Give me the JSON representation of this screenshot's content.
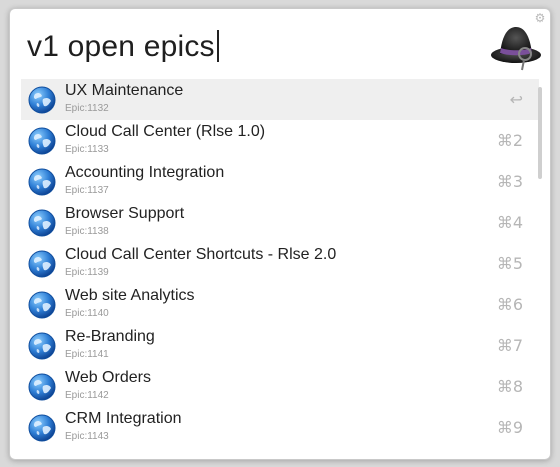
{
  "search": {
    "query": "v1 open epics"
  },
  "results": [
    {
      "title": "UX Maintenance",
      "subtitle": "Epic:1132",
      "shortcut": "↩"
    },
    {
      "title": "Cloud Call Center (Rlse 1.0)",
      "subtitle": "Epic:1133",
      "shortcut": "⌘2"
    },
    {
      "title": "Accounting Integration",
      "subtitle": "Epic:1137",
      "shortcut": "⌘3"
    },
    {
      "title": "Browser Support",
      "subtitle": "Epic:1138",
      "shortcut": "⌘4"
    },
    {
      "title": "Cloud Call Center Shortcuts - Rlse 2.0",
      "subtitle": "Epic:1139",
      "shortcut": "⌘5"
    },
    {
      "title": "Web site Analytics",
      "subtitle": "Epic:1140",
      "shortcut": "⌘6"
    },
    {
      "title": "Re-Branding",
      "subtitle": "Epic:1141",
      "shortcut": "⌘7"
    },
    {
      "title": "Web Orders",
      "subtitle": "Epic:1142",
      "shortcut": "⌘8"
    },
    {
      "title": "CRM Integration",
      "subtitle": "Epic:1143",
      "shortcut": "⌘9"
    }
  ],
  "icons": {
    "settings": "gear-icon",
    "app": "alfred-hat-icon",
    "result": "globe-icon"
  },
  "colors": {
    "selected_row": "#efefef",
    "globe": "#2f7fd6"
  }
}
